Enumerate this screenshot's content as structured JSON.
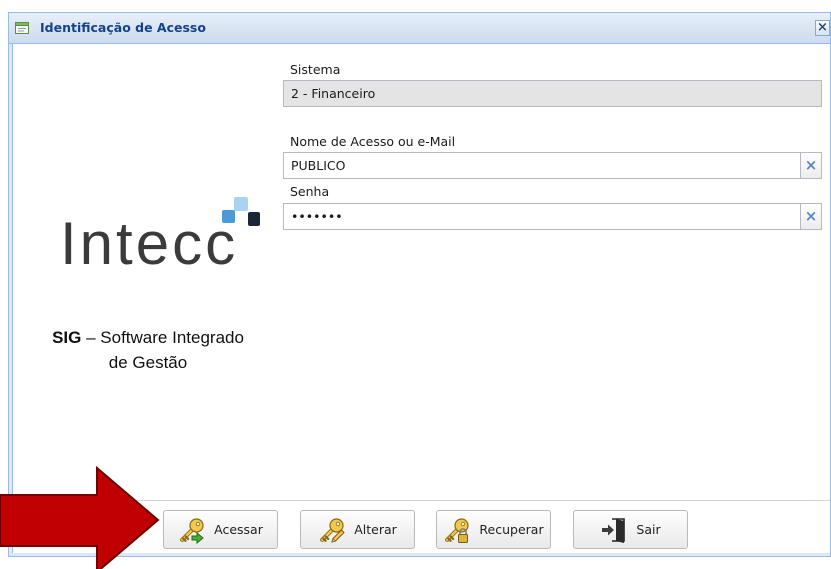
{
  "window": {
    "title": "Identificação de Acesso",
    "title_icon": "form-window-icon",
    "close_label": "×"
  },
  "brand": {
    "logo_text": "Intecc",
    "tagline_bold": "SIG",
    "tagline_rest": "– Software Integrado",
    "tagline_line2": "de Gestão"
  },
  "form": {
    "sistema": {
      "label": "Sistema",
      "value": "2 - Financeiro"
    },
    "usuario": {
      "label": "Nome de Acesso ou e-Mail",
      "value": "PUBLICO",
      "clear_label": "×"
    },
    "senha": {
      "label": "Senha",
      "value": "•••••••",
      "clear_label": "×"
    }
  },
  "toolbar": {
    "buttons": [
      {
        "label": "Acessar",
        "icon": "key-enter-icon"
      },
      {
        "label": "Alterar",
        "icon": "key-edit-icon"
      },
      {
        "label": "Recuperar",
        "icon": "key-lock-icon"
      },
      {
        "label": "Sair",
        "icon": "exit-door-icon"
      }
    ]
  },
  "annotation": {
    "icon": "red-arrow-right-icon"
  },
  "colors": {
    "title_text": "#15428b",
    "clear_x": "#5a86c2",
    "annotation_arrow": "#c00000"
  }
}
